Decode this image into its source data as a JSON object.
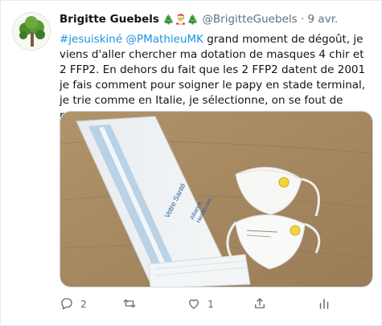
{
  "tweet": {
    "author_name": "Brigitte Guebels",
    "author_emojis": "🎄🎅🎄",
    "handle": "@BrigitteGuebels",
    "separator": "·",
    "date": "9 avr.",
    "text_parts": {
      "hashtag": "#jesuiskiné",
      "mention": "@PMathieuMK",
      "body": " grand moment de dégoût, je viens d'aller chercher ma dotation de masques 4 chir et 2 FFP2. En dehors du fait que les 2 FFP2 datent de 2001 je fais comment pour soigner le papy en stade terminal, je trie comme en Italie, je sélectionne, on se fout de nous!"
    },
    "image_labels": {
      "bag_text_1": "Votre Santé",
      "bag_text_2": "Alliance",
      "bag_text_3": "Healthcare"
    },
    "actions": {
      "reply_count": "2",
      "retweet_count": "",
      "like_count": "1"
    }
  },
  "icons": {
    "avatar": "tree-icon",
    "reply": "reply-icon",
    "retweet": "retweet-icon",
    "like": "heart-icon",
    "share": "share-icon",
    "analytics": "analytics-icon"
  },
  "colors": {
    "link": "#1b95e0",
    "muted": "#5b7083",
    "border": "#e6ecf0"
  }
}
